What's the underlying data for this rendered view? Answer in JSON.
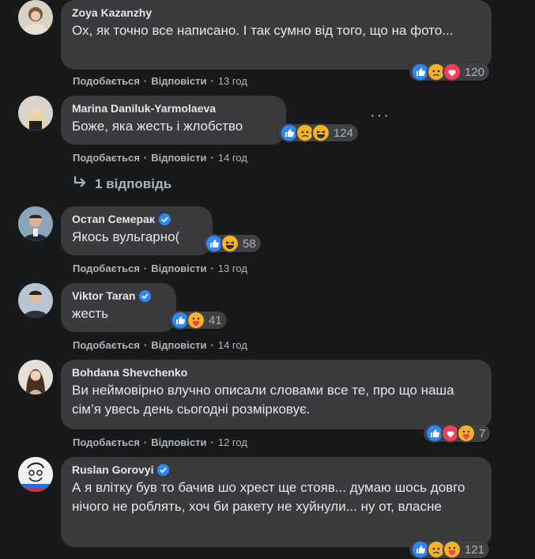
{
  "comments": [
    {
      "author": "Zoya Kazanzhy",
      "verified": false,
      "text": "Ох, як точно все написано. І так сумно від того, що на фото...",
      "reactions": [
        "like",
        "sad",
        "love"
      ],
      "reaction_count": "120",
      "like_label": "Подобається",
      "reply_label": "Відповісти",
      "time": "13 год"
    },
    {
      "author": "Marina Daniluk-Yarmolaeva",
      "verified": false,
      "text": "Боже, яка жесть і жлобство",
      "reactions": [
        "like",
        "sad",
        "haha"
      ],
      "reaction_count": "124",
      "like_label": "Подобається",
      "reply_label": "Відповісти",
      "time": "14 год",
      "replies_label": "1 відповідь"
    },
    {
      "author": "Остап Семерак",
      "verified": true,
      "text": "Якось вульгарно(",
      "reactions": [
        "like",
        "haha"
      ],
      "reaction_count": "58",
      "like_label": "Подобається",
      "reply_label": "Відповісти",
      "time": "13 год"
    },
    {
      "author": "Viktor Taran",
      "verified": true,
      "text": "жесть",
      "reactions": [
        "like",
        "care"
      ],
      "reaction_count": "41",
      "like_label": "Подобається",
      "reply_label": "Відповісти",
      "time": "14 год"
    },
    {
      "author": "Bohdana Shevchenko",
      "verified": false,
      "text": "Ви неймовірно влучно описали словами все те, про що наша сім’я увесь день сьогодні розмірковує.",
      "reactions": [
        "like",
        "love",
        "care"
      ],
      "reaction_count": "7",
      "like_label": "Подобається",
      "reply_label": "Відповісти",
      "time": "12 год"
    },
    {
      "author": "Ruslan Gorovyi",
      "verified": true,
      "text": "А я влітку був то бачив шо хрест ще стояв... думаю шось довго нічого не роблять, хоч би ракету не хуйнули... ну от, власне",
      "reactions": [
        "like",
        "sad",
        "care"
      ],
      "reaction_count": "121"
    }
  ],
  "colors": {
    "background": "#18191a",
    "bubble": "#3a3b3c",
    "text": "#e4e6eb",
    "secondary": "#b0b3b8",
    "like": "#2d88ff",
    "love": "#f33e58",
    "reaction_yellow": "#f7b125"
  },
  "icons": [
    "like-icon",
    "sad-icon",
    "love-icon",
    "haha-icon",
    "care-icon",
    "verified-icon",
    "more-icon",
    "reply-arrow-icon"
  ]
}
